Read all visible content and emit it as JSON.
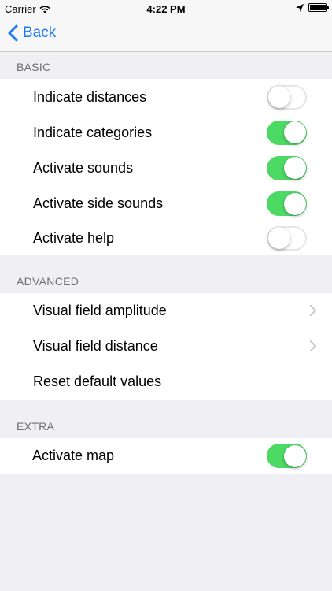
{
  "status_bar": {
    "carrier": "Carrier",
    "time": "4:22 PM"
  },
  "nav": {
    "back_label": "Back"
  },
  "sections": {
    "basic": {
      "header": "BASIC",
      "rows": [
        {
          "label": "Indicate distances",
          "toggle": false
        },
        {
          "label": "Indicate categories",
          "toggle": true
        },
        {
          "label": "Activate sounds",
          "toggle": true
        },
        {
          "label": "Activate side sounds",
          "toggle": true
        },
        {
          "label": "Activate help",
          "toggle": false
        }
      ]
    },
    "advanced": {
      "header": "ADVANCED",
      "rows": [
        {
          "label": "Visual field amplitude"
        },
        {
          "label": "Visual field distance"
        },
        {
          "label": "Reset default values"
        }
      ]
    },
    "extra": {
      "header": "EXTRA",
      "rows": [
        {
          "label": "Activate map",
          "toggle": true
        }
      ]
    }
  },
  "colors": {
    "accent": "#1a7cf5",
    "toggle_on": "#4cd964",
    "background": "#efeff4"
  }
}
